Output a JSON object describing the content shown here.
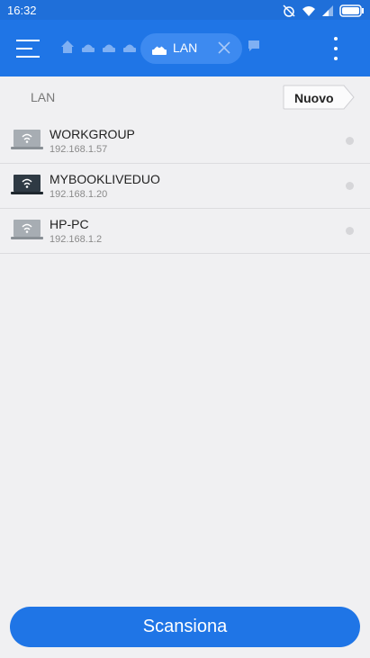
{
  "status_bar": {
    "time": "16:32"
  },
  "header": {
    "active_tab": "LAN",
    "accent_color": "#1f75e6"
  },
  "path": {
    "current": "LAN",
    "new_label": "Nuovo"
  },
  "devices": [
    {
      "name": "WORKGROUP",
      "ip": "192.168.1.57",
      "icon": "laptop-wifi-icon"
    },
    {
      "name": "MYBOOKLIVEDUO",
      "ip": "192.168.1.20",
      "icon": "laptop-wifi-icon"
    },
    {
      "name": "HP-PC",
      "ip": "192.168.1.2",
      "icon": "laptop-wifi-icon"
    }
  ],
  "footer": {
    "scan_label": "Scansiona"
  }
}
